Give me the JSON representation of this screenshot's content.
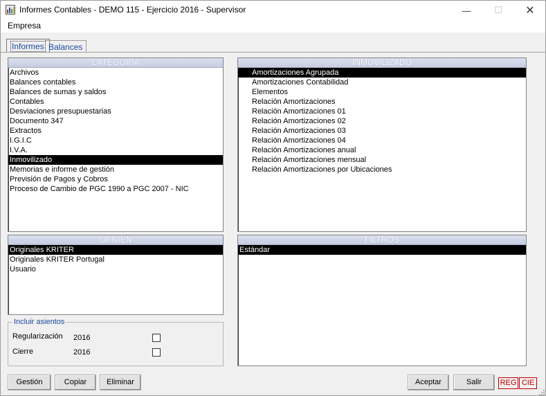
{
  "window": {
    "title": "Informes Contables - DEMO 115 - Ejercicio 2016 - Supervisor",
    "minimize": "—",
    "maximize": "☐",
    "close": "✕"
  },
  "menu": {
    "items": [
      "Empresa"
    ]
  },
  "tabs": {
    "informes": "Informes",
    "balances": "Balances",
    "active": "Informes"
  },
  "categoria": {
    "header": "CATEGORÍA",
    "items": [
      "Archivos",
      "Balances contables",
      "Balances de sumas y saldos",
      "Contables",
      "Desviaciones presupuestarias",
      "Documento 347",
      "Extractos",
      "I.G.I.C",
      "I.V.A.",
      "Inmovilizado",
      "Memorias e informe de gestión",
      "Previsión de Pagos y Cobros",
      "Proceso de Cambio de PGC 1990 a PGC 2007 - NIC"
    ],
    "selected": "Inmovilizado"
  },
  "inmovilizado": {
    "header": "INMOVILIZADO",
    "items": [
      "Amortizaciones Agrupada",
      "Amortizaciones Contabilidad",
      "Elementos",
      "Relación Amortizaciones",
      "Relación Amortizaciones 01",
      "Relación Amortizaciones 02",
      "Relación Amortizaciones 03",
      "Relación Amortizaciones 04",
      "Relación Amortizaciones anual",
      "Relación Amortizaciones mensual",
      "Relación Amortizaciones por Ubicaciones"
    ],
    "selected": "Amortizaciones Agrupada"
  },
  "origen": {
    "header": "ORIGEN",
    "items": [
      "Originales KRITER",
      "Originales KRITER Portugal",
      "Usuario"
    ],
    "selected": "Originales KRITER"
  },
  "filtros": {
    "header": "FILTROS",
    "items": [
      "Estándar"
    ],
    "selected": "Estándar"
  },
  "incluir_asientos": {
    "title": "Incluir asientos",
    "regularizacion": {
      "label": "Regularización",
      "year": "2016",
      "checked": false
    },
    "cierre": {
      "label": "Cierre",
      "year": "2016",
      "checked": false
    }
  },
  "buttons": {
    "gestion": "Gestión",
    "copiar": "Copiar",
    "eliminar": "Eliminar",
    "aceptar": "Aceptar",
    "salir": "Salir"
  },
  "status": {
    "reg": "REG",
    "cie": "CIE"
  },
  "colors": {
    "accent": "#1a4aa0",
    "status_red": "#c00000",
    "header_bg": "#cdd3e6",
    "selection": "#000000"
  }
}
